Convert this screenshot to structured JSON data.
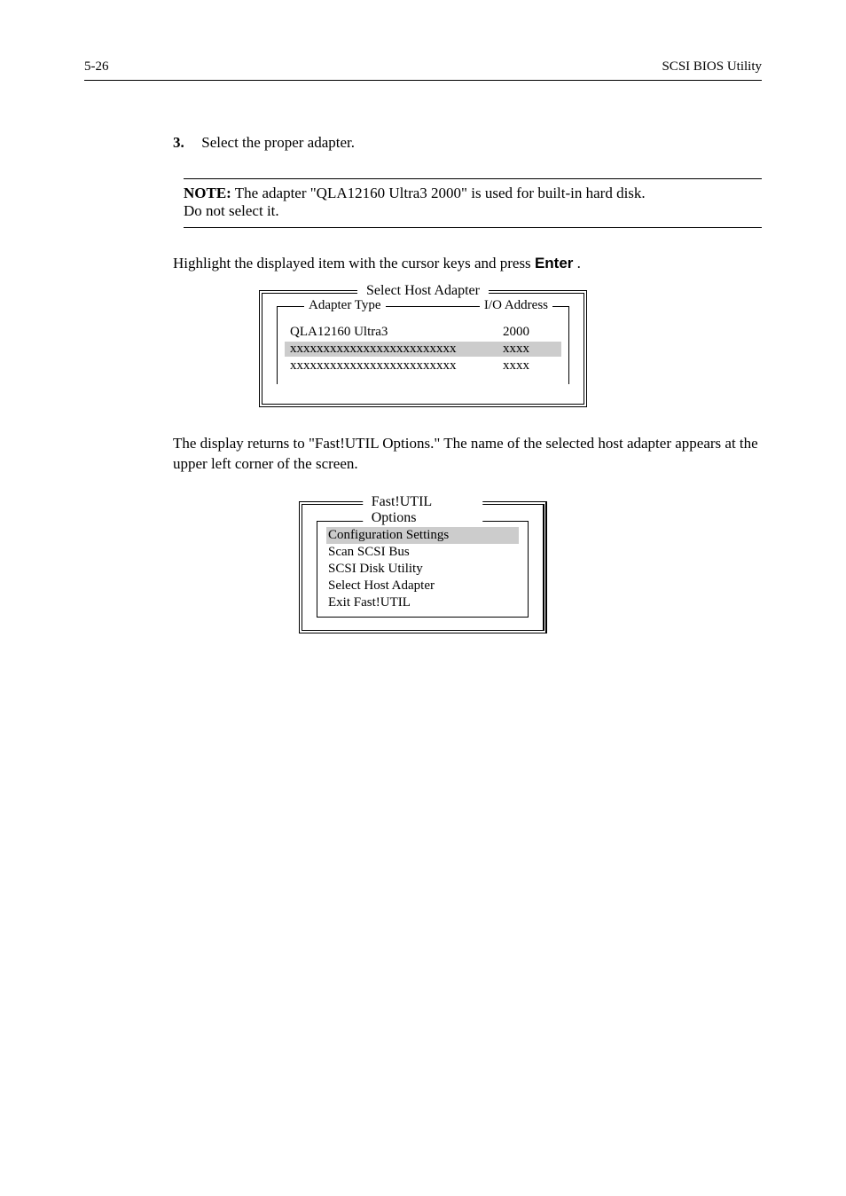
{
  "header": {
    "page_number": "5-26",
    "section_title": "SCSI BIOS Utility"
  },
  "step": {
    "number": "3.",
    "text": "Select the proper adapter."
  },
  "note": {
    "label": "NOTE:",
    "text_line1": " The adapter \"QLA12160 Ultra3 2000\" is used for built-in hard disk.",
    "text_line2": "Do not select it."
  },
  "body": {
    "highlight_line_prefix": "Highlight the displayed item with the cursor keys and press ",
    "enter_label": "Enter",
    "highlight_line_suffix": "."
  },
  "sha_box": {
    "title": "Select Host Adapter",
    "col_left": "Adapter Type",
    "col_right": "I/O Address",
    "rows": [
      {
        "type": "QLA12160 Ultra3",
        "io": "2000",
        "hl": false
      },
      {
        "type": "xxxxxxxxxxxxxxxxxxxxxxxxx",
        "io": "xxxx",
        "hl": true
      },
      {
        "type": "xxxxxxxxxxxxxxxxxxxxxxxxx",
        "io": "xxxx",
        "hl": false
      }
    ]
  },
  "after_text": "The display returns to \"Fast!UTIL Options.\" The name of the selected host adapter appears at the upper left corner of the screen.",
  "futil_box": {
    "title": "Fast!UTIL Options",
    "items": [
      {
        "label": "Configuration Settings",
        "hl": true
      },
      {
        "label": "Scan SCSI Bus",
        "hl": false
      },
      {
        "label": "SCSI Disk Utility",
        "hl": false
      },
      {
        "label": "Select Host Adapter",
        "hl": false
      },
      {
        "label": "Exit Fast!UTIL",
        "hl": false
      }
    ]
  }
}
